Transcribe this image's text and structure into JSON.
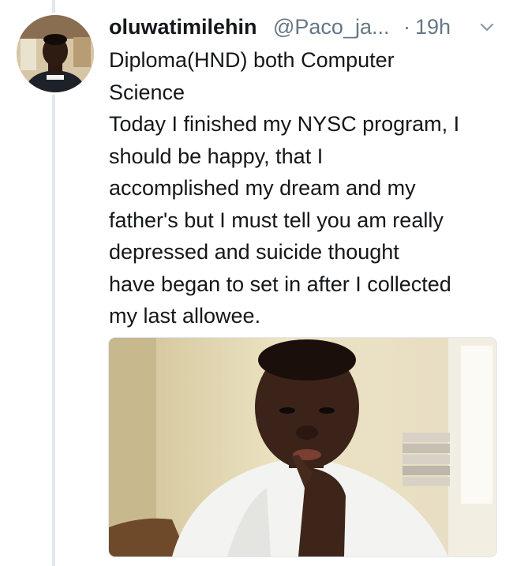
{
  "tweet": {
    "display_name": "oluwatimilehin",
    "handle": "@Paco_ja...",
    "separator": "·",
    "time": "19h",
    "text_lines": [
      "Diploma(HND) both Computer",
      "Science",
      "Today I finished my NYSC program, I",
      "should be happy, that I",
      "accomplished my dream and my",
      "father's but I must tell you am really",
      "depressed and suicide thought",
      "have began to set in after I collected",
      "my last allowee."
    ]
  },
  "colors": {
    "name": "#14171a",
    "secondary_text": "#657786",
    "thread_line": "#e1e8ed",
    "background": "#ffffff"
  },
  "icons": {
    "menu": "chevron-down-icon"
  }
}
